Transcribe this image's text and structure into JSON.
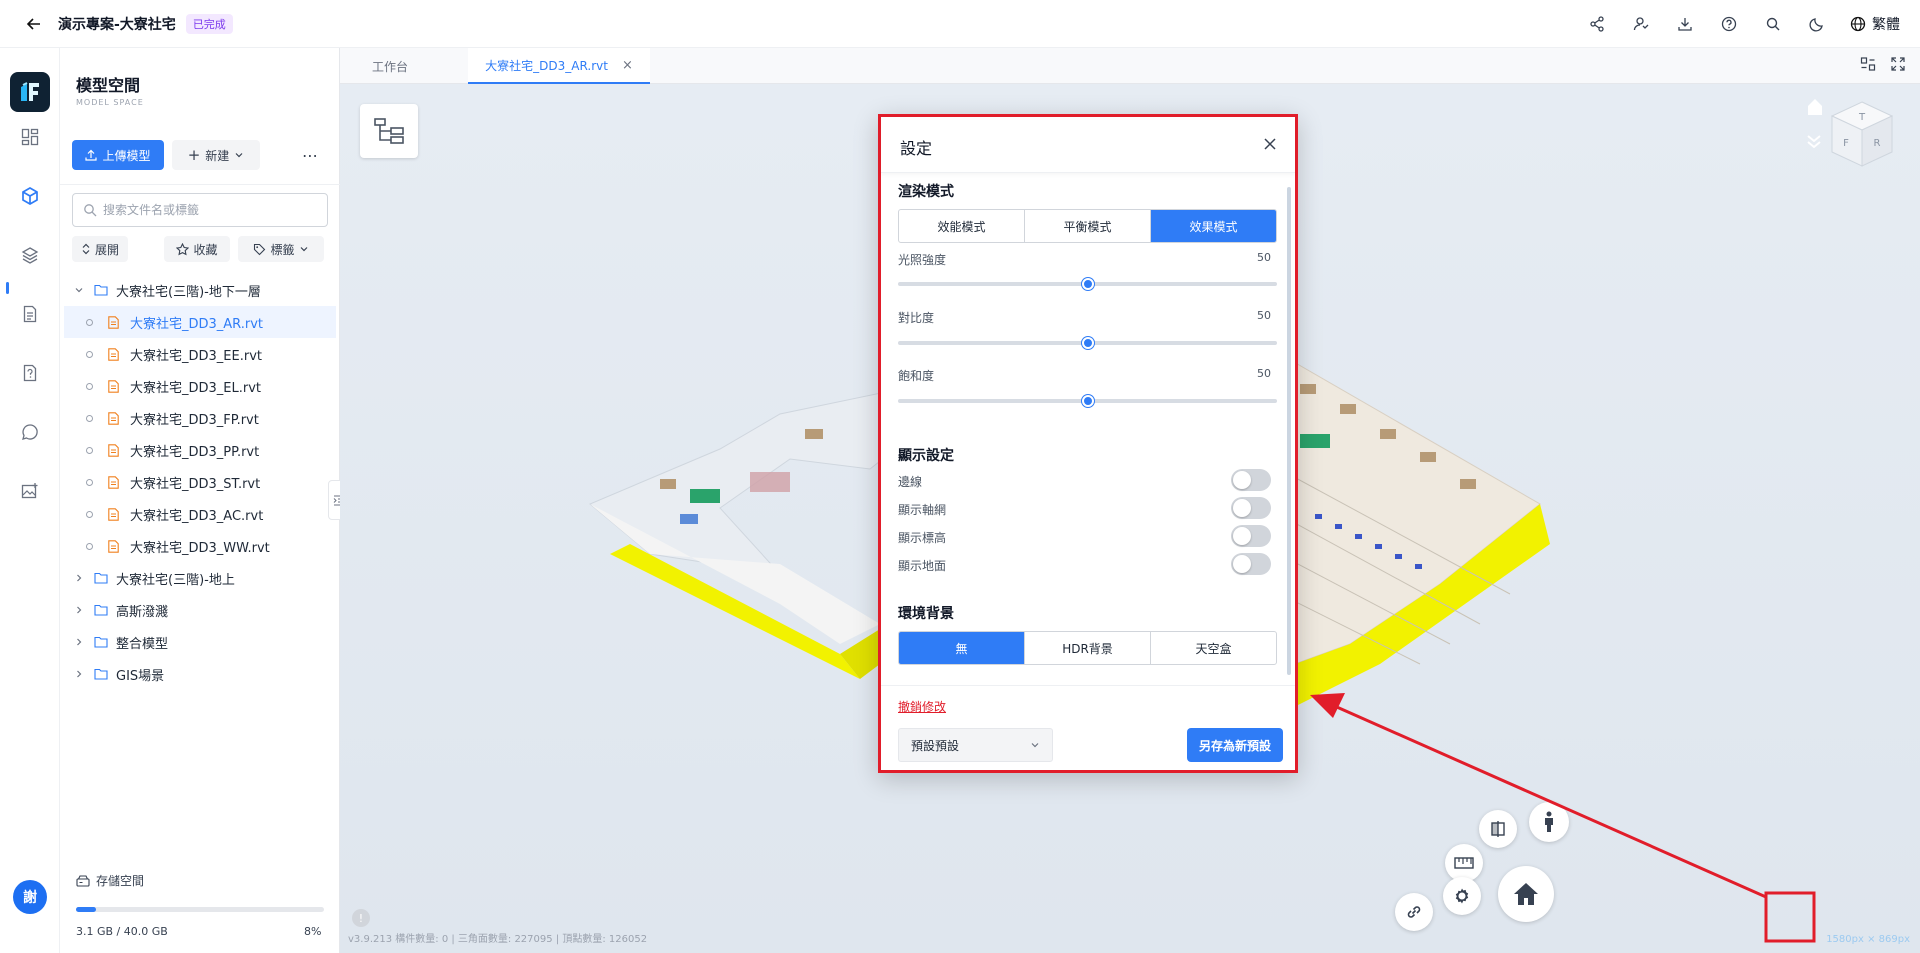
{
  "header": {
    "project_title": "演示專案-大寮社宅",
    "status_badge": "已完成",
    "language": "繁體",
    "icons": [
      "share-icon",
      "member-icon",
      "download-icon",
      "help-icon",
      "search-icon",
      "dark-mode-icon",
      "globe-icon"
    ]
  },
  "rail": {
    "avatar_text": "謝",
    "items": [
      "dashboard-icon",
      "model-space-icon",
      "layers-icon",
      "document-icon",
      "file-question-icon",
      "chat-icon",
      "image-add-icon"
    ]
  },
  "panel": {
    "title": "模型空間",
    "subtitle": "MODEL SPACE",
    "upload_label": "上傳模型",
    "new_label": "新建",
    "search_placeholder": "搜索文件名或標籤",
    "filters": {
      "expand": "展開",
      "favorite": "收藏",
      "tags": "標籤"
    },
    "tree": {
      "folder_open": "大寮社宅(三階)-地下一層",
      "files": [
        "大寮社宅_DD3_AR.rvt",
        "大寮社宅_DD3_EE.rvt",
        "大寮社宅_DD3_EL.rvt",
        "大寮社宅_DD3_FP.rvt",
        "大寮社宅_DD3_PP.rvt",
        "大寮社宅_DD3_ST.rvt",
        "大寮社宅_DD3_AC.rvt",
        "大寮社宅_DD3_WW.rvt"
      ],
      "other_folders": [
        "大寮社宅(三階)-地上",
        "高斯潑濺",
        "整合模型",
        "GIS場景"
      ]
    },
    "storage": {
      "label": "存儲空間",
      "used": "3.1 GB / 40.0 GB",
      "percent_text": "8%",
      "fraction": 0.08
    }
  },
  "tabs": [
    {
      "label": "工作台"
    },
    {
      "label": "大寮社宅_DD3_AR.rvt"
    }
  ],
  "viewer": {
    "info": "v3.9.213   構件數量: 0 | 三角面數量: 227095 | 頂點數量: 126052",
    "resolution": "1580px × 869px",
    "cube_faces": {
      "top": "T",
      "front": "F",
      "right": "R"
    }
  },
  "settings_dialog": {
    "title": "設定",
    "render_mode": {
      "title": "渲染模式",
      "options": [
        "效能模式",
        "平衡模式",
        "效果模式"
      ],
      "selected": "效果模式"
    },
    "sliders": [
      {
        "label": "光照強度",
        "value": 50
      },
      {
        "label": "對比度",
        "value": 50
      },
      {
        "label": "飽和度",
        "value": 50
      }
    ],
    "display": {
      "title": "顯示設定",
      "toggles": [
        {
          "label": "邊線",
          "on": false
        },
        {
          "label": "顯示軸網",
          "on": false
        },
        {
          "label": "顯示標高",
          "on": false
        },
        {
          "label": "顯示地面",
          "on": false
        }
      ]
    },
    "environment": {
      "title": "環境背景",
      "options": [
        "無",
        "HDR背景",
        "天空盒"
      ],
      "selected": "無"
    },
    "undo_label": "撤銷修改",
    "preset_value": "預設預設",
    "save_preset_label": "另存為新預設"
  },
  "colors": {
    "accent": "#2f7cf6",
    "highlight_red": "#e11d2a",
    "model_yellow": "#f2f200"
  }
}
